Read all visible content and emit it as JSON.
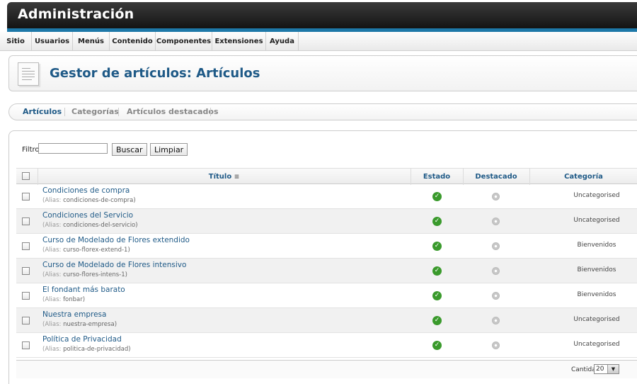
{
  "header": {
    "title": "Administración"
  },
  "menu": [
    "Sitio",
    "Usuarios",
    "Menús",
    "Contenido",
    "Componentes",
    "Extensiones",
    "Ayuda"
  ],
  "page": {
    "title": "Gestor de artículos: Artículos"
  },
  "subnav": [
    "Artículos",
    "Categorías",
    "Artículos destacados"
  ],
  "filter": {
    "label": "Filtro:",
    "value": "",
    "search_button": "Buscar",
    "clear_button": "Limpiar"
  },
  "table": {
    "columns": {
      "title": "Título",
      "status": "Estado",
      "featured": "Destacado",
      "category": "Categoría"
    },
    "alias_prefix": "(Alias:",
    "rows": [
      {
        "title": "Condiciones de compra",
        "alias": "condiciones-de-compra",
        "category": "Uncategorised"
      },
      {
        "title": "Condiciones del Servicio",
        "alias": "condiciones-del-servicio",
        "category": "Uncategorised"
      },
      {
        "title": "Curso de Modelado de Flores extendido",
        "alias": "curso-florex-extend-1",
        "category": "Bienvenidos"
      },
      {
        "title": "Curso de Modelado de Flores intensivo",
        "alias": "curso-flores-intens-1",
        "category": "Bienvenidos"
      },
      {
        "title": "El fondant más barato",
        "alias": "fonbar",
        "category": "Bienvenidos"
      },
      {
        "title": "Nuestra empresa",
        "alias": "nuestra-empresa",
        "category": "Uncategorised"
      },
      {
        "title": "Política de Privacidad",
        "alias": "politica-de-privacidad",
        "category": "Uncategorised"
      }
    ]
  },
  "pagination": {
    "label": "Cantidad",
    "value": "20"
  },
  "colors": {
    "brand_blue": "#1f5a87",
    "header_stripe": "#1d78a8",
    "status_green": "#3a9a2c"
  }
}
